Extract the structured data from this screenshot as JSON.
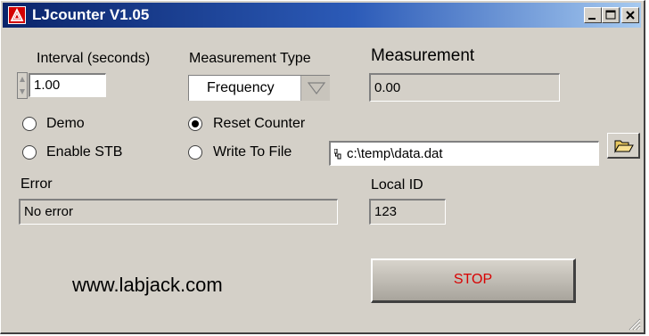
{
  "window": {
    "title": "LJcounter V1.05"
  },
  "interval": {
    "label": "Interval (seconds)",
    "value": "1.00"
  },
  "measurement_type": {
    "label": "Measurement Type",
    "selected": "Frequency"
  },
  "measurement": {
    "label": "Measurement",
    "value": "0.00"
  },
  "options": {
    "demo": {
      "label": "Demo",
      "checked": false
    },
    "enable_stb": {
      "label": "Enable STB",
      "checked": false
    },
    "reset_counter": {
      "label": "Reset Counter",
      "checked": true
    },
    "write_to_file": {
      "label": "Write To File",
      "checked": false
    }
  },
  "file_path": {
    "value": "c:\\temp\\data.dat"
  },
  "error": {
    "label": "Error",
    "value": "No error"
  },
  "local_id": {
    "label": "Local ID",
    "value": "123"
  },
  "url": "www.labjack.com",
  "stop_button": {
    "label": "STOP",
    "color": "#d80000"
  },
  "colors": {
    "titlebar_start": "#0a246a",
    "titlebar_end": "#a6caf0",
    "window_bg": "#d4d0c8"
  },
  "icons": [
    "labjack-app-icon",
    "minimize-icon",
    "maximize-icon",
    "close-icon",
    "spinner-arrows-icon",
    "dropdown-arrow-icon",
    "path-icon",
    "folder-open-icon",
    "resize-grip-icon"
  ]
}
